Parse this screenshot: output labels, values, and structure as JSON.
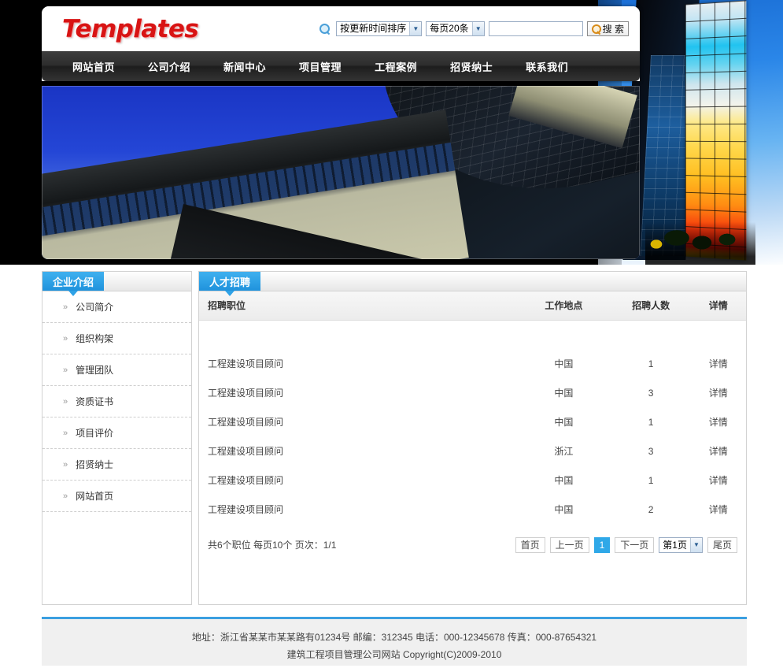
{
  "site": {
    "logo_text": "Templates"
  },
  "search": {
    "magnifier_icon": "search-icon",
    "sort_select": "按更新时间排序",
    "perpage_select": "每页20条",
    "keyword_value": "",
    "keyword_placeholder": "",
    "button_label": "搜 索",
    "arrow_glyph": "▼"
  },
  "nav": {
    "items": [
      {
        "label": "网站首页"
      },
      {
        "label": "公司介绍"
      },
      {
        "label": "新闻中心"
      },
      {
        "label": "项目管理"
      },
      {
        "label": "工程案例"
      },
      {
        "label": "招贤纳士"
      },
      {
        "label": "联系我们"
      }
    ]
  },
  "banner": {
    "alt": "仰视高楼与蓝天的建筑照片"
  },
  "sidebar": {
    "tab_label": "企业介绍",
    "chevron_glyph": "»",
    "items": [
      {
        "label": "公司简介"
      },
      {
        "label": "组织构架"
      },
      {
        "label": "管理团队"
      },
      {
        "label": "资质证书"
      },
      {
        "label": "项目评价"
      },
      {
        "label": "招贤纳士"
      },
      {
        "label": "网站首页"
      }
    ]
  },
  "main": {
    "tab_label": "人才招聘",
    "table": {
      "columns": [
        "招聘职位",
        "工作地点",
        "招聘人数",
        "详情"
      ],
      "rows": [
        {
          "position": "工程建设项目顾问",
          "location": "中国",
          "count": "1",
          "detail": "详情"
        },
        {
          "position": "工程建设项目顾问",
          "location": "中国",
          "count": "3",
          "detail": "详情"
        },
        {
          "position": "工程建设项目顾问",
          "location": "中国",
          "count": "1",
          "detail": "详情"
        },
        {
          "position": "工程建设项目顾问",
          "location": "浙江",
          "count": "3",
          "detail": "详情"
        },
        {
          "position": "工程建设项目顾问",
          "location": "中国",
          "count": "1",
          "detail": "详情"
        },
        {
          "position": "工程建设项目顾问",
          "location": "中国",
          "count": "2",
          "detail": "详情"
        }
      ]
    },
    "pagination": {
      "info": "共6个职位 每页10个 页次：1/1",
      "first": "首页",
      "prev": "上一页",
      "current": "1",
      "next": "下一页",
      "jump_select": "第1页",
      "jump_arrow": "▼",
      "last": "尾页"
    }
  },
  "footer": {
    "line1": "地址：浙江省某某市某某路有01234号 邮编：312345 电话：000-12345678 传真：000-87654321",
    "line2": "建筑工程项目管理公司网站  Copyright(C)2009-2010"
  },
  "colors": {
    "accent_blue": "#2fa8e8",
    "logo_red": "#d81414",
    "nav_dark": "#2e2e2e",
    "footer_border": "#3b9fe0",
    "page_bg": "#000000"
  }
}
